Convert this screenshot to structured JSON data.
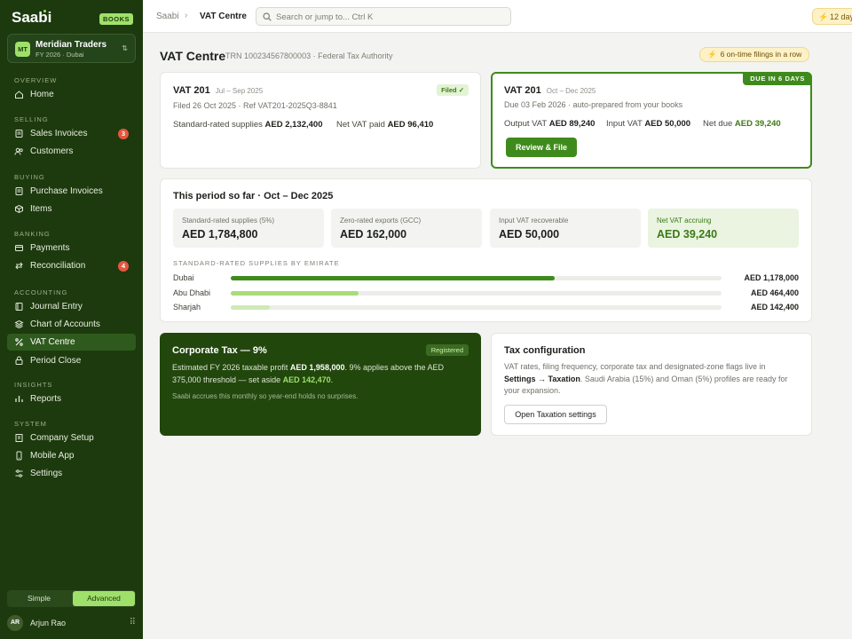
{
  "app": {
    "name": "Saabi",
    "badge": "BOOKS"
  },
  "org": {
    "initials": "MT",
    "name": "Meridian Traders",
    "sub": "FY 2026 · Dubai"
  },
  "sidebar": {
    "sections": [
      {
        "label": "OVERVIEW",
        "items": [
          {
            "label": "Home",
            "icon": "home-icon"
          }
        ]
      },
      {
        "label": "SELLING",
        "items": [
          {
            "label": "Sales Invoices",
            "icon": "invoice-icon",
            "badge": "3"
          },
          {
            "label": "Customers",
            "icon": "customers-icon"
          }
        ]
      },
      {
        "label": "BUYING",
        "items": [
          {
            "label": "Purchase Invoices",
            "icon": "invoice-icon"
          },
          {
            "label": "Items",
            "icon": "box-icon"
          }
        ]
      },
      {
        "label": "BANKING",
        "items": [
          {
            "label": "Payments",
            "icon": "payments-icon"
          },
          {
            "label": "Reconciliation",
            "icon": "reconcile-icon",
            "badge": "4"
          }
        ]
      },
      {
        "label": "ACCOUNTING",
        "items": [
          {
            "label": "Journal Entry",
            "icon": "journal-icon"
          },
          {
            "label": "Chart of Accounts",
            "icon": "layers-icon"
          },
          {
            "label": "VAT Centre",
            "icon": "percent-icon",
            "active": true
          },
          {
            "label": "Period Close",
            "icon": "lock-icon"
          }
        ]
      },
      {
        "label": "INSIGHTS",
        "items": [
          {
            "label": "Reports",
            "icon": "chart-icon"
          }
        ]
      },
      {
        "label": "SYSTEM",
        "items": [
          {
            "label": "Company Setup",
            "icon": "building-icon"
          },
          {
            "label": "Mobile App",
            "icon": "mobile-icon"
          },
          {
            "label": "Settings",
            "icon": "sliders-icon"
          }
        ]
      }
    ],
    "mode": {
      "simple": "Simple",
      "advanced": "Advanced",
      "selected": "Advanced"
    },
    "user": {
      "initials": "AR",
      "name": "Arjun Rao"
    }
  },
  "topbar": {
    "crumb_root": "Saabi",
    "crumb_current": "VAT Centre",
    "search_placeholder": "Search or jump to...  Ctrl K",
    "streak": "12 day"
  },
  "header": {
    "title": "VAT Centre",
    "trn": "TRN 100234567800003 · Federal Tax Authority",
    "streak_pill": "6 on-time filings in a row"
  },
  "filed_return": {
    "title": "VAT 201",
    "period": "Jul – Sep 2025",
    "status": "Filed ✓",
    "meta": "Filed 26 Oct 2025 · Ref VAT201-2025Q3-8841",
    "k1": "Standard-rated supplies",
    "v1": "AED 2,132,400",
    "k2": "Net VAT paid",
    "v2": "AED 96,410"
  },
  "due_return": {
    "title": "VAT 201",
    "period": "Oct – Dec 2025",
    "ribbon": "DUE IN 6 DAYS",
    "meta": "Due 03 Feb 2026 · auto-prepared from your books",
    "k1": "Output VAT",
    "v1": "AED 89,240",
    "k2": "Input VAT",
    "v2": "AED 50,000",
    "k3": "Net due",
    "v3": "AED 39,240",
    "button": "Review & File"
  },
  "period": {
    "title": "This period so far · Oct – Dec 2025",
    "stats": [
      {
        "label": "Standard-rated supplies (5%)",
        "value": "AED 1,784,800"
      },
      {
        "label": "Zero-rated exports (GCC)",
        "value": "AED 162,000"
      },
      {
        "label": "Input VAT recoverable",
        "value": "AED 50,000"
      },
      {
        "label": "Net VAT accruing",
        "value": "AED 39,240"
      }
    ],
    "bars_title": "STANDARD-RATED SUPPLIES BY EMIRATE",
    "bars": [
      {
        "label": "Dubai",
        "value": "AED 1,178,000",
        "amount": 1178000,
        "color": "#3f8a1c"
      },
      {
        "label": "Abu Dhabi",
        "value": "AED 464,400",
        "amount": 464400,
        "color": "#a9dc7c"
      },
      {
        "label": "Sharjah",
        "value": "AED 142,400",
        "amount": 142400,
        "color": "#cfeab5"
      }
    ],
    "bar_max": 1784800
  },
  "corporate": {
    "title": "Corporate Tax — 9%",
    "tag": "Registered",
    "t1": "Estimated FY 2026 taxable profit ",
    "v1": "AED 1,958,000",
    "t2": ". 9% applies above the AED 375,000 threshold — set aside ",
    "v2": "AED 142,470",
    "t3": ".",
    "note": "Saabi accrues this monthly so year-end holds no surprises."
  },
  "taxconfig": {
    "title": "Tax configuration",
    "t1": "VAT rates, filing frequency, corporate tax and designated-zone flags live in ",
    "v1": "Settings → Taxation",
    "t2": ". Saudi Arabia (15%) and Oman (5%) profiles are ready for your expansion.",
    "button": "Open Taxation settings"
  }
}
